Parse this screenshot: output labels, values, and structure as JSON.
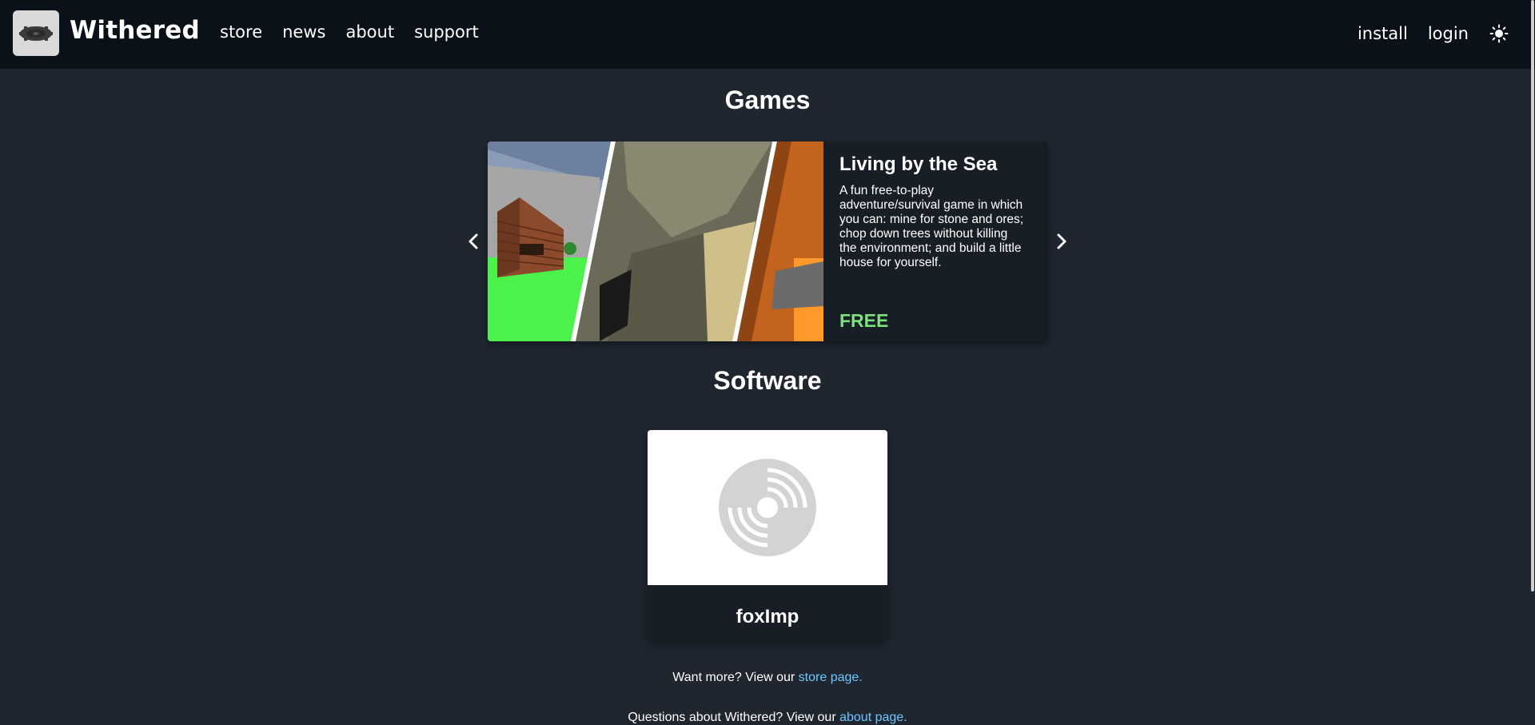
{
  "brand": {
    "name": "Withered",
    "logo_icon": "disc-logo-icon"
  },
  "nav": {
    "left": [
      {
        "label": "store"
      },
      {
        "label": "news"
      },
      {
        "label": "about"
      },
      {
        "label": "support"
      }
    ],
    "right": [
      {
        "label": "install"
      },
      {
        "label": "login"
      }
    ],
    "theme_icon": "sun-icon"
  },
  "games": {
    "title": "Games",
    "prev_icon": "chevron-left-icon",
    "next_icon": "chevron-right-icon",
    "featured": {
      "title": "Living by the Sea",
      "description": "A fun free-to-play adventure/survival game in which you can: mine for stone and ores; chop down trees without killing the environment; and build a little house for yourself.",
      "price": "FREE"
    }
  },
  "software": {
    "title": "Software",
    "items": [
      {
        "name": "foxImp",
        "thumb_icon": "disc-placeholder-icon"
      }
    ]
  },
  "footer": {
    "more_prefix": "Want more? View our ",
    "more_link": "store page.",
    "questions_prefix": "Questions about Withered? View our ",
    "questions_link": "about page."
  },
  "colors": {
    "background": "#1f2630",
    "navbar": "#0b1118",
    "card": "#181e26",
    "price_green": "#7ce07c",
    "link_blue": "#6ec6ff"
  }
}
